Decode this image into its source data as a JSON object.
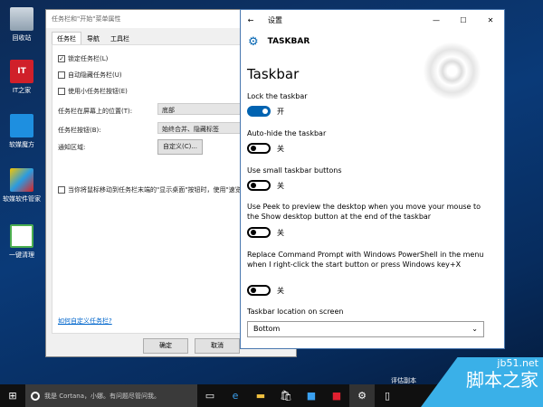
{
  "desktop": {
    "icons": [
      {
        "label": "回收站"
      },
      {
        "label": "IT之家"
      },
      {
        "label": "软媒魔方"
      },
      {
        "label": "软媒软件管家"
      },
      {
        "label": "一键清理"
      }
    ],
    "eval_text": "评估副本"
  },
  "dialog": {
    "title": "任务栏和\"开始\"菜单属性",
    "tabs": [
      "任务栏",
      "导航",
      "工具栏"
    ],
    "lock": "锁定任务栏(L)",
    "autohide": "自动隐藏任务栏(U)",
    "small": "使用小任务栏按钮(E)",
    "location_label": "任务栏在屏幕上的位置(T):",
    "location_value": "底部",
    "buttons_label": "任务栏按钮(B):",
    "buttons_value": "始终合并、隐藏标签",
    "notify_label": "通知区域:",
    "customize": "自定义(C)...",
    "peek": "当你将鼠标移动到任务栏末端的\"显示桌面\"按钮时，使用\"速览\"预览桌面(P)",
    "link": "如何自定义任务栏?",
    "ok": "确定",
    "cancel": "取消"
  },
  "settings": {
    "title": "设置",
    "header": "TASKBAR",
    "heading": "Taskbar",
    "items": [
      {
        "label": "Lock the taskbar",
        "state": "开",
        "on": true
      },
      {
        "label": "Auto-hide the taskbar",
        "state": "关",
        "on": false
      },
      {
        "label": "Use small taskbar buttons",
        "state": "关",
        "on": false
      },
      {
        "label": "Use Peek to preview the desktop when you move your mouse to the Show desktop button at the end of the taskbar",
        "state": "关",
        "on": false
      },
      {
        "label": "Replace Command Prompt with Windows PowerShell in the menu when I right-click the start button or press Windows key+X",
        "state": "关",
        "on": false
      }
    ],
    "location_label": "Taskbar location on screen",
    "location_value": "Bottom"
  },
  "taskbar": {
    "search_placeholder": "我是 Cortana，小娜。有问题尽管问我。"
  },
  "watermark": {
    "site": "jb51.net",
    "name": "脚本之家"
  }
}
